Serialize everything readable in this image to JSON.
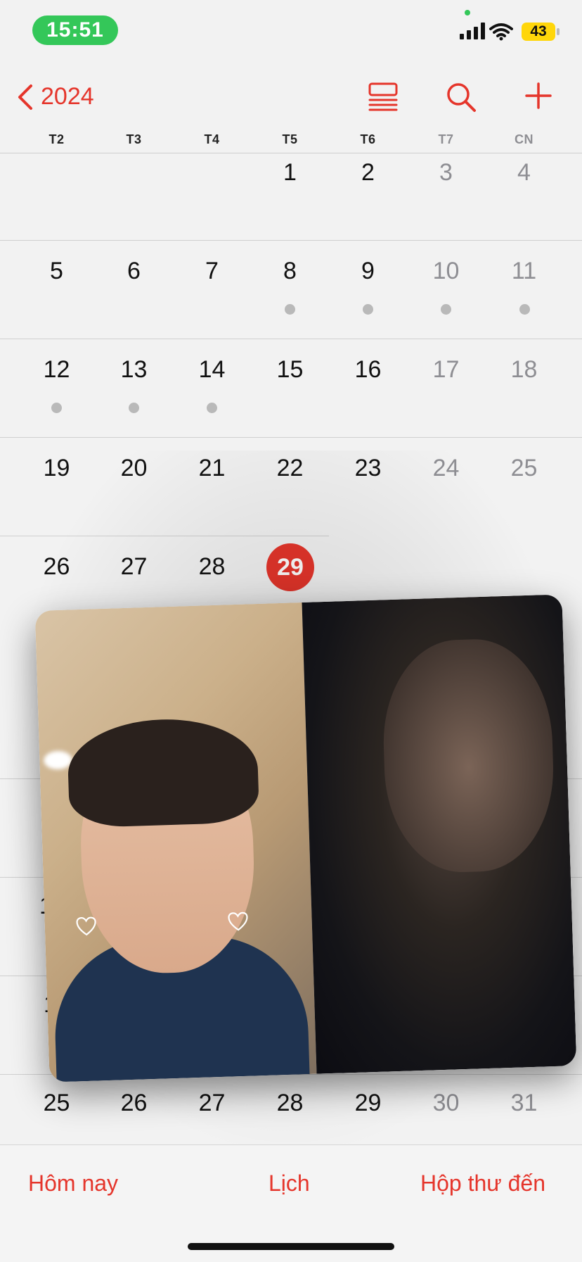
{
  "status_bar": {
    "time": "15:51",
    "battery": "43",
    "icons": [
      "signal-icon",
      "wifi-icon",
      "battery-icon"
    ]
  },
  "nav": {
    "back_label": "2024",
    "icons": [
      "chevron-left-icon",
      "list-view-icon",
      "search-icon",
      "plus-icon"
    ]
  },
  "weekdays": [
    "T2",
    "T3",
    "T4",
    "T5",
    "T6",
    "T7",
    "CN"
  ],
  "calendar": {
    "weeks": [
      [
        "",
        "",
        "",
        "1",
        "2",
        "3",
        "4"
      ],
      [
        "5",
        "6",
        "7",
        "8",
        "9",
        "10",
        "11"
      ],
      [
        "12",
        "13",
        "14",
        "15",
        "16",
        "17",
        "18"
      ],
      [
        "19",
        "20",
        "21",
        "22",
        "23",
        "24",
        "25"
      ],
      [
        "26",
        "27",
        "28",
        "29",
        "",
        "",
        ""
      ],
      [
        "25",
        "26",
        "27",
        "28",
        "29",
        "30",
        "31"
      ]
    ],
    "today": "29",
    "partial_visible": [
      "1",
      "1"
    ]
  },
  "tabs": {
    "today": "Hôm nay",
    "calendars": "Lịch",
    "inbox": "Hộp thư đến"
  },
  "colors": {
    "accent": "#e5352b",
    "status_green": "#34c759",
    "battery_yellow": "#ffd60a"
  }
}
